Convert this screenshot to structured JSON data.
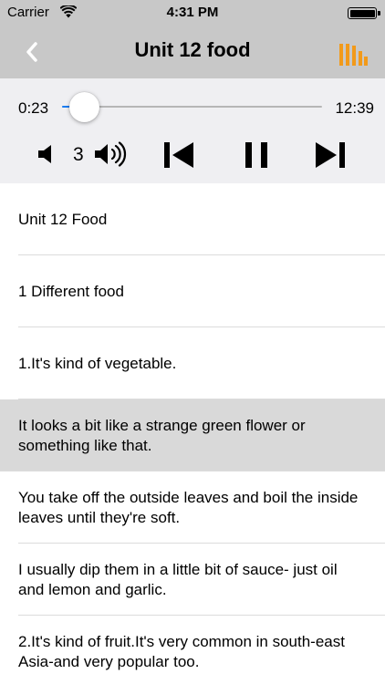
{
  "status_bar": {
    "carrier": "Carrier",
    "time": "4:31 PM",
    "wifi_icon": "wifi-icon",
    "battery_icon": "battery-full-icon"
  },
  "nav": {
    "title": "Unit 12 food",
    "back_icon": "chevron-left-icon",
    "playlist_icon": "playlist-bars-icon",
    "accent_color": "#f29a1a"
  },
  "player": {
    "current_time": "0:23",
    "total_time": "12:39",
    "progress_fraction": 0.03,
    "volume_level": "3",
    "controls": [
      "volume-down-icon",
      "volume-up-icon",
      "previous-track-icon",
      "pause-icon",
      "next-track-icon"
    ],
    "progress_color": "#1a7cf2"
  },
  "list": {
    "selected_index": 3,
    "items": [
      {
        "text": "Unit 12 Food"
      },
      {
        "text": "1 Different food"
      },
      {
        "text": "1.It's kind of vegetable."
      },
      {
        "text": "It looks a bit like a strange green flower or something like that."
      },
      {
        "text": "You take off the outside leaves and boil the inside leaves until they're soft."
      },
      {
        "text": "I usually dip them in a little bit of sauce- just oil and lemon and garlic."
      },
      {
        "text": "2.It's kind of fruit.It's very common in south-east Asia-and very popular too."
      }
    ]
  }
}
